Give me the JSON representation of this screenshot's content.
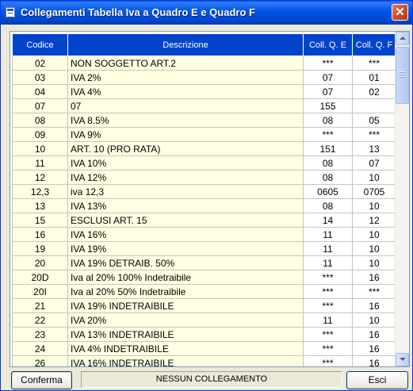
{
  "window": {
    "title": "Collegamenti Tabella Iva a Quadro E e Quadro F",
    "close_glyph": "✕"
  },
  "table": {
    "headers": [
      "Codice",
      "Descrizione",
      "Coll. Q. E",
      "Coll. Q. F"
    ],
    "rows": [
      [
        "02",
        "NON SOGGETTO ART.2",
        "***",
        "***"
      ],
      [
        "03",
        "IVA 2%",
        "07",
        "01"
      ],
      [
        "04",
        "IVA 4%",
        "07",
        "02"
      ],
      [
        "07",
        "07",
        "155",
        ""
      ],
      [
        "08",
        "IVA 8.5%",
        "08",
        "05"
      ],
      [
        "09",
        "IVA 9%",
        "***",
        "***"
      ],
      [
        "10",
        "ART. 10 (PRO RATA)",
        "151",
        "13"
      ],
      [
        "11",
        "IVA 10%",
        "08",
        "07"
      ],
      [
        "12",
        "IVA 12%",
        "08",
        "10"
      ],
      [
        "12,3",
        "iva 12,3",
        "0605",
        "0705"
      ],
      [
        "13",
        "IVA 13%",
        "08",
        "10"
      ],
      [
        "15",
        "ESCLUSI ART. 15",
        "14",
        "12"
      ],
      [
        "16",
        "IVA 16%",
        "11",
        "10"
      ],
      [
        "19",
        "IVA 19%",
        "11",
        "10"
      ],
      [
        "20",
        "IVA 19% DETRAIB. 50%",
        "11",
        "10"
      ],
      [
        "20D",
        "Iva al 20% 100% Indetraibile",
        "***",
        "16"
      ],
      [
        "20I",
        "Iva al 20% 50% Indetraibile",
        "***",
        "***"
      ],
      [
        "21",
        "IVA 19% INDETRAIBILE",
        "***",
        "16"
      ],
      [
        "22",
        "IVA 20%",
        "11",
        "10"
      ],
      [
        "23",
        "IVA 13% INDETRAIBILE",
        "***",
        "16"
      ],
      [
        "24",
        "IVA 4%  INDETRAIBILE",
        "***",
        "16"
      ],
      [
        "26",
        "IVA 16% INDETRAIBILE",
        "***",
        "16"
      ]
    ]
  },
  "footer": {
    "confirm_label": "Conferma",
    "status_text": "NESSUN COLLEGAMENTO",
    "exit_label": "Esci"
  },
  "colors": {
    "header_bg": "#0044CC",
    "code_desc_bg": "#FFFFE1",
    "titlebar": "#0055E5"
  }
}
